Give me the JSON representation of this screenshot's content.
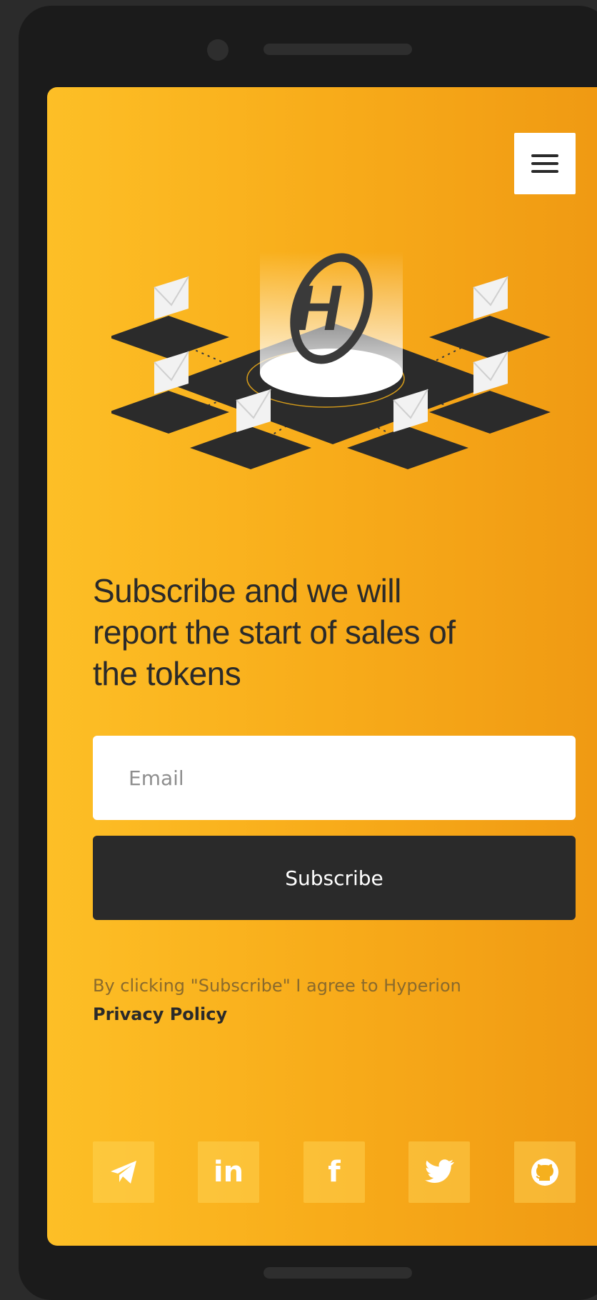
{
  "menu": {
    "icon": "hamburger-icon"
  },
  "hero": {
    "logo_letter": "H",
    "headline": "Subscribe and we will report the start of sales of the tokens"
  },
  "form": {
    "email_placeholder": "Email",
    "email_value": "",
    "subscribe_label": "Subscribe"
  },
  "consent": {
    "text": "By clicking \"Subscribe\" I agree to Hyperion",
    "link": "Privacy Policy"
  },
  "socials": [
    {
      "icon": "telegram-icon"
    },
    {
      "icon": "linkedin-icon",
      "glyph": "in"
    },
    {
      "icon": "facebook-icon",
      "glyph": "f"
    },
    {
      "icon": "twitter-icon"
    },
    {
      "icon": "github-icon"
    }
  ],
  "colors": {
    "gradient_start": "#fdbf26",
    "gradient_end": "#ef9812",
    "dark": "#2a2a2a",
    "white": "#ffffff"
  }
}
